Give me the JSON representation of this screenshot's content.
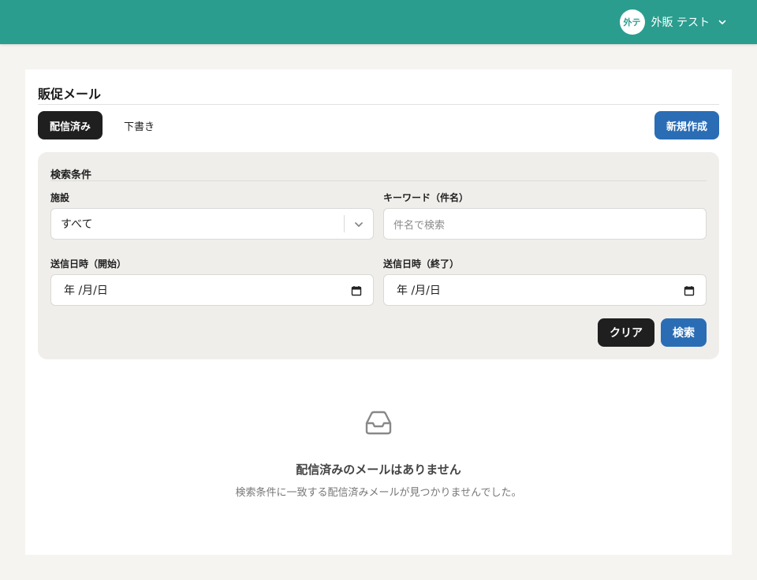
{
  "header": {
    "user_initials": "外テ",
    "user_name": "外販 テスト"
  },
  "page": {
    "title": "販促メール",
    "tabs": [
      {
        "label": "配信済み",
        "active": true
      },
      {
        "label": "下書き",
        "active": false
      }
    ],
    "new_button": "新規作成"
  },
  "filters": {
    "section_title": "検索条件",
    "facility": {
      "label": "施設",
      "value": "すべて"
    },
    "keyword": {
      "label": "キーワード（件名）",
      "placeholder": "件名で検索"
    },
    "date_start": {
      "label": "送信日時（開始）",
      "value": "年 /月/日"
    },
    "date_end": {
      "label": "送信日時（終了）",
      "value": "年 /月/日"
    },
    "clear_button": "クリア",
    "search_button": "検索"
  },
  "empty_state": {
    "icon": "inbox-icon",
    "title": "配信済みのメールはありません",
    "message": "検索条件に一致する配信済みメールが見つかりませんでした。"
  },
  "colors": {
    "header": "#2a9d8f",
    "primary_button": "#2a6db5",
    "dark_button": "#1f1f1f"
  }
}
